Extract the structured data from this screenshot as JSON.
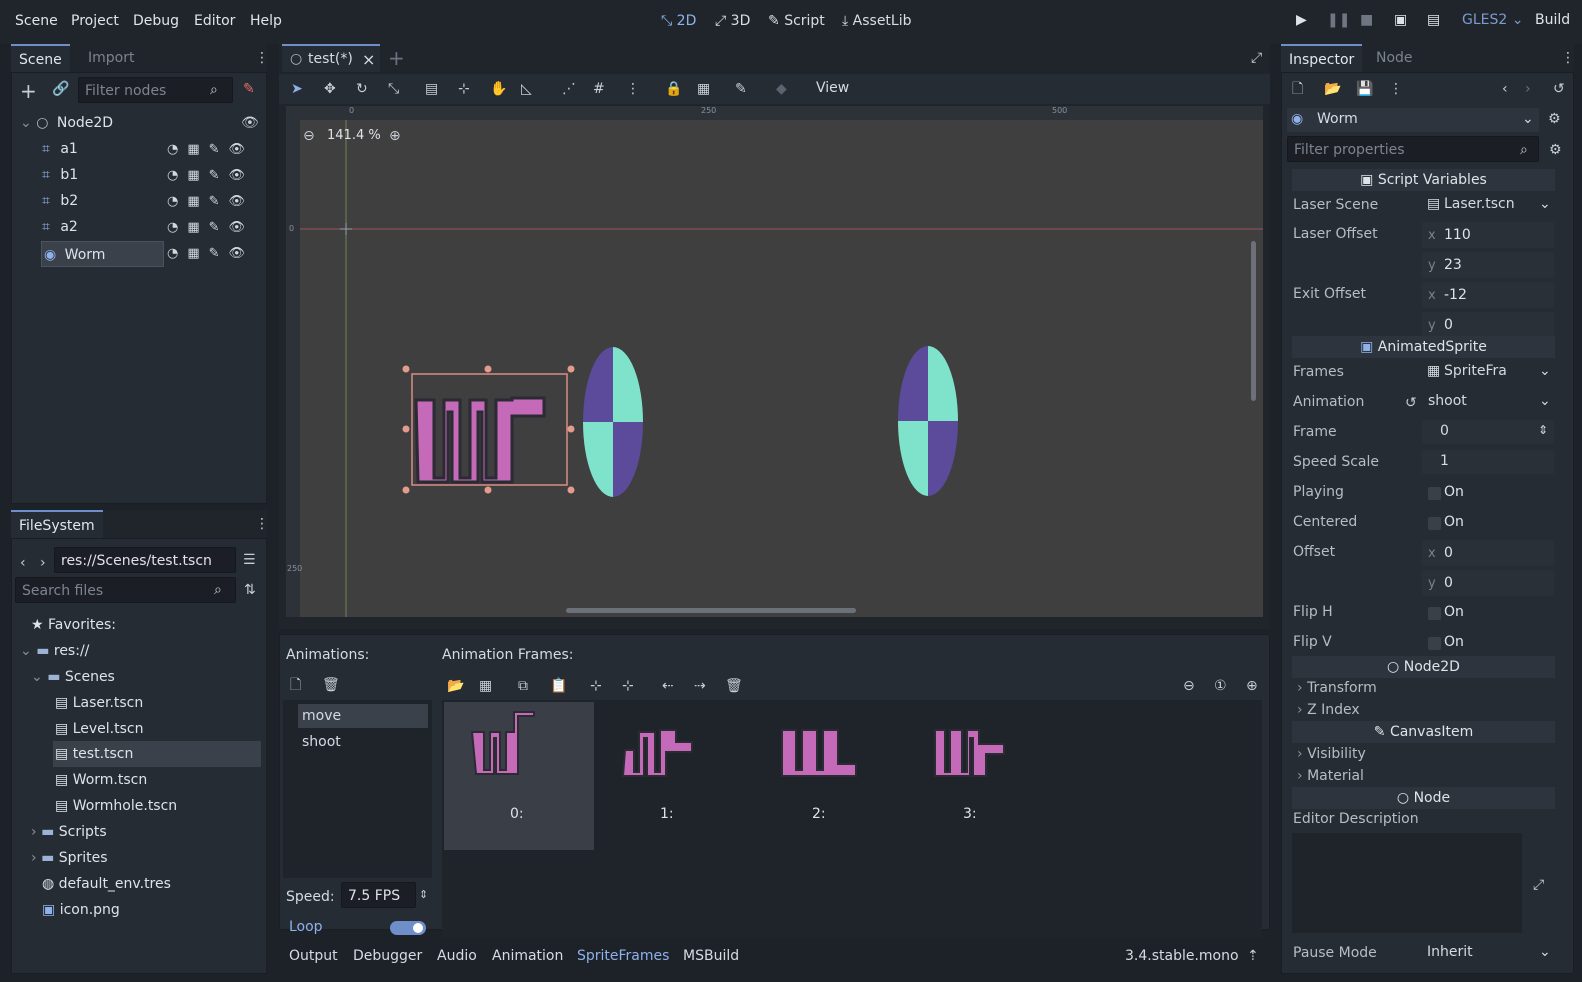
{
  "menu": [
    "Scene",
    "Project",
    "Debug",
    "Editor",
    "Help"
  ],
  "workspaces": [
    {
      "label": "2D",
      "icon": "2d-icon",
      "active": true
    },
    {
      "label": "3D",
      "icon": "3d-icon",
      "active": false
    },
    {
      "label": "Script",
      "icon": "script-icon",
      "active": false
    },
    {
      "label": "AssetLib",
      "icon": "assetlib-icon",
      "active": false
    }
  ],
  "renderer": "GLES2",
  "build_label": "Build",
  "scene_dock": {
    "tabs": [
      "Scene",
      "Import"
    ],
    "filter_placeholder": "Filter nodes",
    "nodes": [
      {
        "name": "Node2D",
        "icon": "node2d-icon"
      },
      {
        "name": "a1",
        "icon": "area2d-icon"
      },
      {
        "name": "b1",
        "icon": "area2d-icon"
      },
      {
        "name": "b2",
        "icon": "area2d-icon"
      },
      {
        "name": "a2",
        "icon": "area2d-icon"
      },
      {
        "name": "Worm",
        "icon": "kinematic-icon",
        "selected": true
      }
    ]
  },
  "filesystem": {
    "title": "FileSystem",
    "path": "res://Scenes/test.tscn",
    "search_placeholder": "Search files",
    "items": [
      {
        "label": "Favorites:",
        "icon": "star-icon"
      },
      {
        "label": "res://",
        "icon": "folder-icon"
      },
      {
        "label": "Scenes",
        "icon": "folder-icon"
      },
      {
        "label": "Laser.tscn",
        "icon": "scene-icon"
      },
      {
        "label": "Level.tscn",
        "icon": "scene-icon"
      },
      {
        "label": "test.tscn",
        "icon": "scene-icon",
        "selected": true
      },
      {
        "label": "Worm.tscn",
        "icon": "scene-icon"
      },
      {
        "label": "Wormhole.tscn",
        "icon": "scene-icon"
      },
      {
        "label": "Scripts",
        "icon": "folder-icon"
      },
      {
        "label": "Sprites",
        "icon": "folder-icon"
      },
      {
        "label": "default_env.tres",
        "icon": "environment-icon"
      },
      {
        "label": "icon.png",
        "icon": "image-icon"
      }
    ]
  },
  "editor": {
    "scene_tab": "test(*)",
    "view_menu": "View",
    "zoom": "141.4 %",
    "ruler_marks": [
      "0",
      "250",
      "500"
    ],
    "ruler_v_marks": [
      "0",
      "250"
    ]
  },
  "sprite_frames": {
    "animations_label": "Animations:",
    "frames_label": "Animation Frames:",
    "animations": [
      "move",
      "shoot"
    ],
    "selected_animation": "move",
    "frames": [
      "0:",
      "1:",
      "2:",
      "3:"
    ],
    "speed_label": "Speed:",
    "speed_value": "7.5 FPS",
    "loop_label": "Loop",
    "loop_enabled": true
  },
  "bottom_tabs": [
    "Output",
    "Debugger",
    "Audio",
    "Animation",
    "SpriteFrames",
    "MSBuild"
  ],
  "active_bottom_tab": "SpriteFrames",
  "version": "3.4.stable.mono",
  "inspector": {
    "tabs": [
      "Inspector",
      "Node"
    ],
    "object_name": "Worm",
    "filter_placeholder": "Filter properties",
    "sections": {
      "script_variables": "Script Variables",
      "animated_sprite": "AnimatedSprite",
      "node2d": "Node2D",
      "canvas_item": "CanvasItem",
      "node": "Node"
    },
    "laser_scene_label": "Laser Scene",
    "laser_scene_value": "Laser.tscn",
    "laser_offset_label": "Laser Offset",
    "laser_offset_x": "110",
    "laser_offset_y": "23",
    "exit_offset_label": "Exit Offset",
    "exit_offset_x": "-12",
    "exit_offset_y": "0",
    "frames_label": "Frames",
    "frames_value": "SpriteFra",
    "animation_label": "Animation",
    "animation_value": "shoot",
    "frame_label": "Frame",
    "frame_value": "0",
    "speed_scale_label": "Speed Scale",
    "speed_scale_value": "1",
    "playing_label": "Playing",
    "centered_label": "Centered",
    "on_label": "On",
    "offset_label": "Offset",
    "offset_x": "0",
    "offset_y": "0",
    "flip_h_label": "Flip H",
    "flip_v_label": "Flip V",
    "transform_label": "Transform",
    "z_index_label": "Z Index",
    "visibility_label": "Visibility",
    "material_label": "Material",
    "editor_description_label": "Editor Description",
    "pause_mode_label": "Pause Mode",
    "pause_mode_value": "Inherit",
    "axis_x": "x",
    "axis_y": "y"
  },
  "colors": {
    "accent": "#8fb1ea",
    "sprite_pink": "#c46ab8",
    "portal_purple": "#5b4b9a",
    "portal_cyan": "#7fe3cc"
  }
}
